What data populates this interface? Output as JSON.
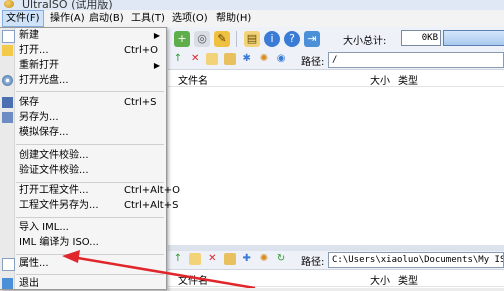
{
  "window": {
    "title": "UltraISO (试用版)"
  },
  "menubar": {
    "items": [
      {
        "key": "file",
        "label": "文件(F)"
      },
      {
        "key": "actions",
        "label": "操作(A)"
      },
      {
        "key": "boot",
        "label": "启动(B)"
      },
      {
        "key": "tools",
        "label": "工具(T)"
      },
      {
        "key": "options",
        "label": "选项(O)"
      },
      {
        "key": "help",
        "label": "帮助(H)"
      }
    ]
  },
  "file_menu": {
    "new": {
      "label": "新建"
    },
    "open": {
      "label": "打开...",
      "shortcut": "Ctrl+O"
    },
    "reopen": {
      "label": "重新打开"
    },
    "open_disc": {
      "label": "打开光盘..."
    },
    "save": {
      "label": "保存",
      "shortcut": "Ctrl+S"
    },
    "save_as": {
      "label": "另存为..."
    },
    "sim_save": {
      "label": "模拟保存..."
    },
    "create_checksum": {
      "label": "创建文件校验..."
    },
    "verify_checksum": {
      "label": "验证文件校验..."
    },
    "open_project": {
      "label": "打开工程文件...",
      "shortcut": "Ctrl+Alt+O"
    },
    "save_project_as": {
      "label": "工程文件另存为...",
      "shortcut": "Ctrl+Alt+S"
    },
    "import_iml": {
      "label": "导入 IML..."
    },
    "compile_iml": {
      "label": "IML 编译为 ISO..."
    },
    "properties": {
      "label": "属性..."
    },
    "exit": {
      "label": "退出"
    }
  },
  "toolbar": {
    "total_size_label": "大小总计:",
    "total_size_value": "0KB"
  },
  "iso_pane": {
    "path_label": "路径:",
    "path_value": "/",
    "col_filename": "文件名",
    "col_size": "大小",
    "col_type": "类型"
  },
  "local_pane": {
    "path_label": "路径:",
    "path_value": "C:\\Users\\xiaoluo\\Documents\\My ISO Fi",
    "col_filename": "文件名",
    "col_size": "大小",
    "col_type": "类型"
  },
  "colors": {
    "menu_highlight": "#cfe3f8",
    "annotation_arrow": "#e0262b"
  }
}
